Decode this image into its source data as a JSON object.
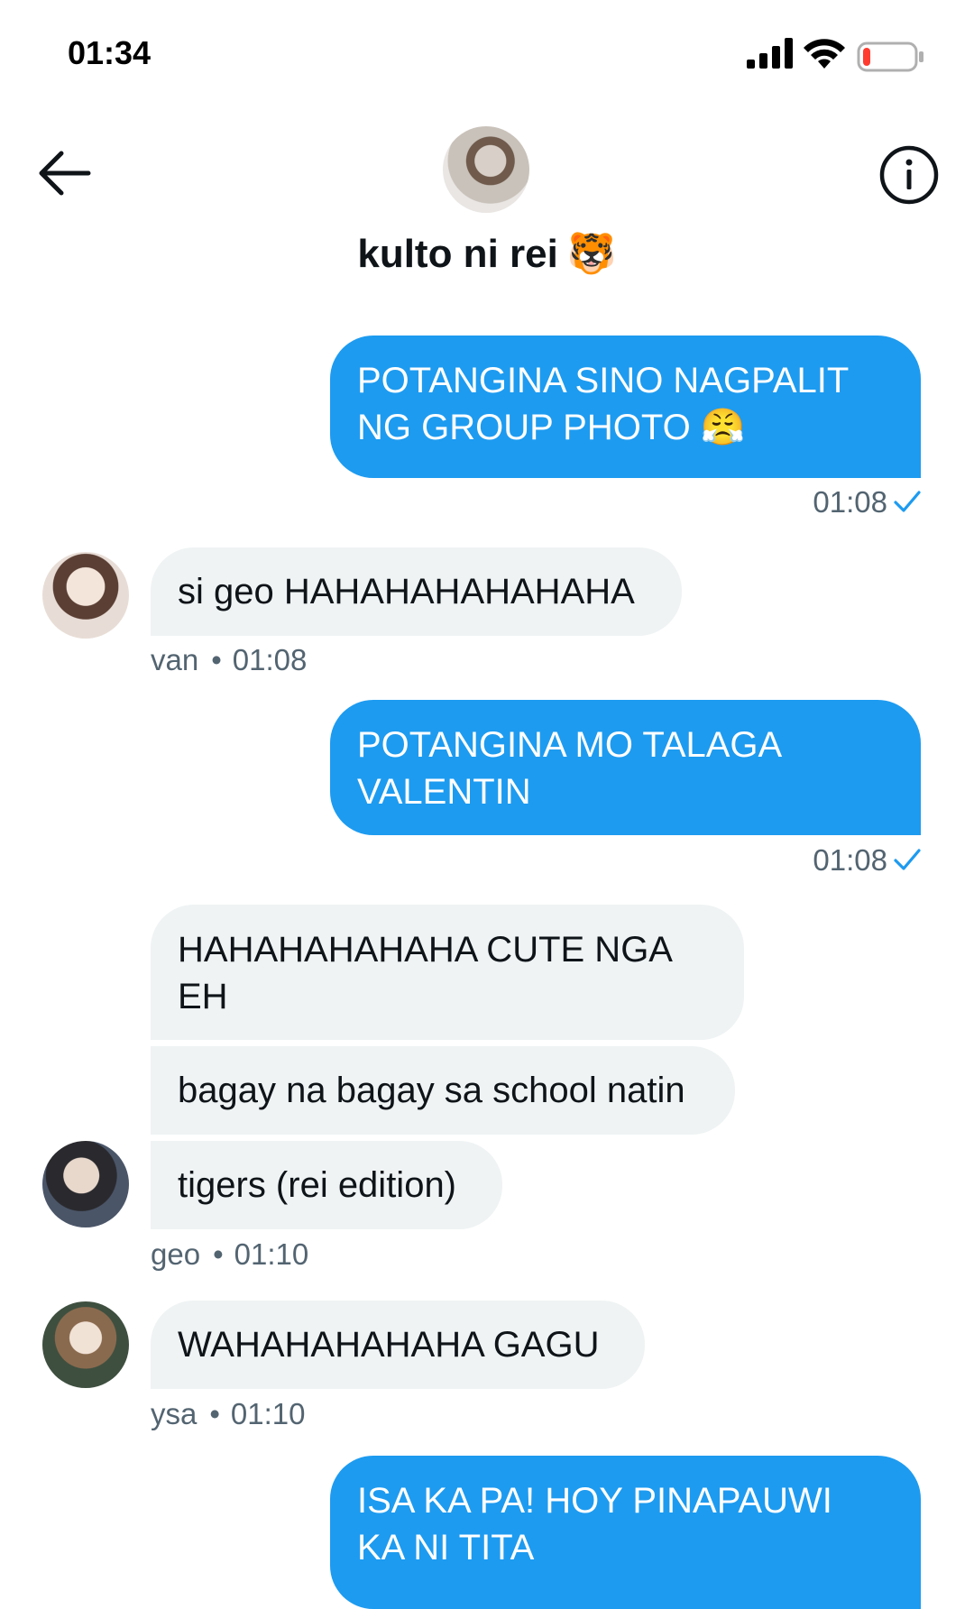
{
  "status_bar": {
    "time": "01:34",
    "battery_level": 0.15,
    "battery_color": "#ff3b30"
  },
  "header": {
    "title": "kulto ni rei",
    "title_emoji": "🐯",
    "back_icon": "arrow-left-icon",
    "info_icon": "info-icon"
  },
  "colors": {
    "sent_bubble": "#1d9bf0",
    "received_bubble": "#eff3f4",
    "meta_text": "#536471"
  },
  "messages": [
    {
      "from": "me",
      "lines": [
        "POTANGINA SINO NAGPALIT",
        "NG GROUP PHOTO 😤"
      ],
      "time": "01:08"
    },
    {
      "from": "van",
      "text": "si geo HAHAHAHAHAHAHA",
      "sender": "van",
      "time": "01:08"
    },
    {
      "from": "me",
      "lines": [
        "POTANGINA MO TALAGA",
        "VALENTIN"
      ],
      "time": "01:08"
    },
    {
      "from": "geo",
      "lines": [
        "HAHAHAHAHAHA CUTE NGA",
        "EH"
      ]
    },
    {
      "from": "geo",
      "text": "bagay na bagay sa school natin"
    },
    {
      "from": "geo",
      "text": "tigers (rei edition)",
      "sender": "geo",
      "time": "01:10"
    },
    {
      "from": "ysa",
      "text": "WAHAHAHAHAHA GAGU",
      "sender": "ysa",
      "time": "01:10"
    },
    {
      "from": "me",
      "lines": [
        "ISA KA PA! HOY PINAPAUWI",
        "KA NI TITA"
      ]
    }
  ],
  "separator": "•"
}
